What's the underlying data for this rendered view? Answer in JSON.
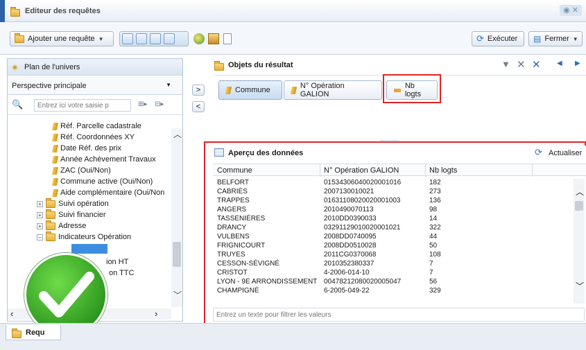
{
  "window": {
    "title": "Editeur des requêtes"
  },
  "toolbar": {
    "add_query_label": "Ajouter une requête",
    "run_label": "Exécuter",
    "close_label": "Fermer"
  },
  "universe": {
    "title": "Plan de l'univers",
    "perspective": "Perspective principale",
    "search_placeholder": "Entrez ici votre saisie p",
    "items": [
      {
        "label": "Réf. Parcelle cadastrale"
      },
      {
        "label": "Réf. Coordonnées XY"
      },
      {
        "label": "Date Réf. des prix"
      },
      {
        "label": "Année Achèvement Travaux"
      },
      {
        "label": "ZAC (Oui/Non)"
      },
      {
        "label": "Commune active (Oui/Non)"
      },
      {
        "label": "Aide complémentaire (Oui/Non"
      },
      {
        "label": "Suivi opération"
      },
      {
        "label": "Suivi financier"
      },
      {
        "label": "Adresse"
      },
      {
        "label": "Indicateurs Opération"
      },
      {
        "label": "ion HT"
      },
      {
        "label": "on TTC"
      }
    ]
  },
  "move": {
    "right": ">",
    "left": "<"
  },
  "result_objects": {
    "title": "Objets du résultat",
    "chips": [
      {
        "label": "Commune"
      },
      {
        "label": "N° Opération GALION"
      },
      {
        "label": "Nb logts"
      }
    ]
  },
  "preview": {
    "title": "Aperçu des données",
    "refresh_label": "Actualiser",
    "columns": [
      "Commune",
      "N° Opération GALION",
      "Nb logts"
    ],
    "rows": [
      [
        "BELFORT",
        "01534306040020001016",
        "182"
      ],
      [
        "CABRIÈS",
        "2007130010021",
        "273"
      ],
      [
        "TRAPPES",
        "01631108020020001003",
        "136"
      ],
      [
        "ANGERS",
        "2010490070113",
        "98"
      ],
      [
        "TASSENIÈRES",
        "2010DD0390033",
        "14"
      ],
      [
        "DRANCY",
        "03291129010020001021",
        "322"
      ],
      [
        "VULBENS",
        "2008DD0740095",
        "44"
      ],
      [
        "FRIGNICOURT",
        "2008DD0510028",
        "50"
      ],
      [
        "TRUYES",
        "2011CG0370068",
        "108"
      ],
      [
        "CESSON-SÉVIGNÉ",
        "2010352380337",
        "7"
      ],
      [
        "CRISTOT",
        "4-2006-014-10",
        "7"
      ],
      [
        "LYON - 9E ARRONDISSEMENT",
        "00478212080020005047",
        "56"
      ],
      [
        "CHAMPIGNÉ",
        "6-2005-049-22",
        "329"
      ]
    ],
    "filter_placeholder": "Entrez un texte pour filtrer les valeurs"
  },
  "bottom_tab": {
    "label": "Requ"
  },
  "colors": {
    "accent": "#2b62a8",
    "highlight_border": "#e02424",
    "check_green": "#39b32c"
  }
}
